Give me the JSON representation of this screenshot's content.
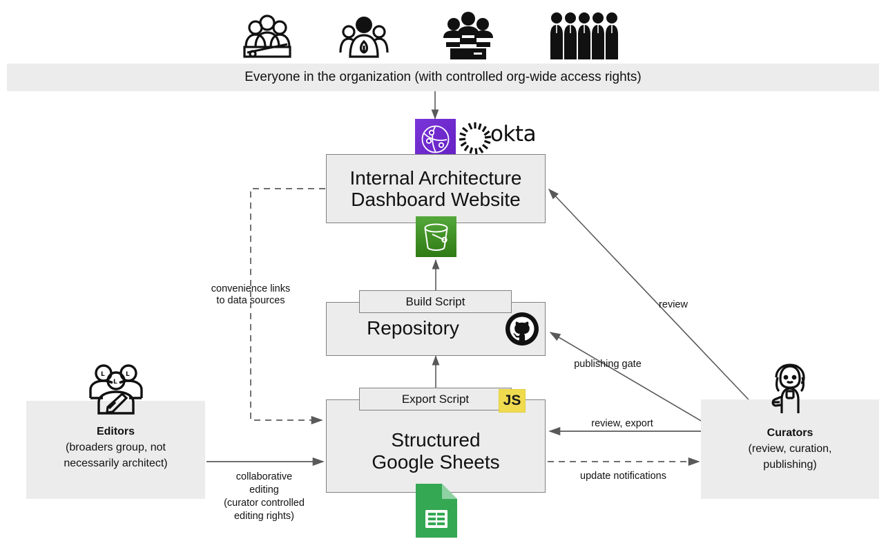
{
  "diagram": {
    "title": "Internal Architecture Dashboard data flow",
    "colors": {
      "box_fill": "#ececec",
      "box_stroke": "#808080",
      "arrow": "#595959",
      "okta_purple": "#6520c4",
      "s3_green": "#3f8f22",
      "js_yellow": "#f0db4f",
      "sheets_green": "#34a853"
    }
  },
  "banner": {
    "text": "Everyone in the organization (with controlled org-wide access rights)",
    "icons": [
      {
        "name": "group-of-people-icon"
      },
      {
        "name": "team-member-badge-icon"
      },
      {
        "name": "team-podium-icon"
      },
      {
        "name": "row-of-people-icon"
      }
    ]
  },
  "nodes": {
    "dashboard": {
      "label": "Internal Architecture\nDashboard Website",
      "auth_badge": {
        "name": "okta-logo",
        "wordmark": "okta"
      },
      "storage_badge": {
        "name": "s3-bucket-icon"
      }
    },
    "build_script": {
      "label": "Build Script"
    },
    "repository": {
      "label": "Repository",
      "badge": {
        "name": "github-logo"
      }
    },
    "export_script": {
      "label": "Export Script",
      "badge": {
        "name": "javascript-logo",
        "text": "JS"
      }
    },
    "sheets": {
      "label": "Structured\nGoogle Sheets",
      "badge": {
        "name": "google-sheets-icon"
      }
    },
    "editors": {
      "title": "Editors",
      "subtitle": "(broaders group, not\nnecessarily architect)",
      "icon": {
        "name": "editors-people-pencil-icon"
      }
    },
    "curators": {
      "title": "Curators",
      "subtitle": "(review, curation,\npublishing)",
      "icon": {
        "name": "curator-person-icon"
      }
    }
  },
  "edges": {
    "convenience_links": "convenience links\nto data sources",
    "review": "review",
    "publishing_gate": "publishing gate",
    "review_export": "review, export",
    "update_notifications": "update notifications",
    "collaborative_editing": "collaborative\nediting\n(curator controlled\nediting rights)"
  }
}
